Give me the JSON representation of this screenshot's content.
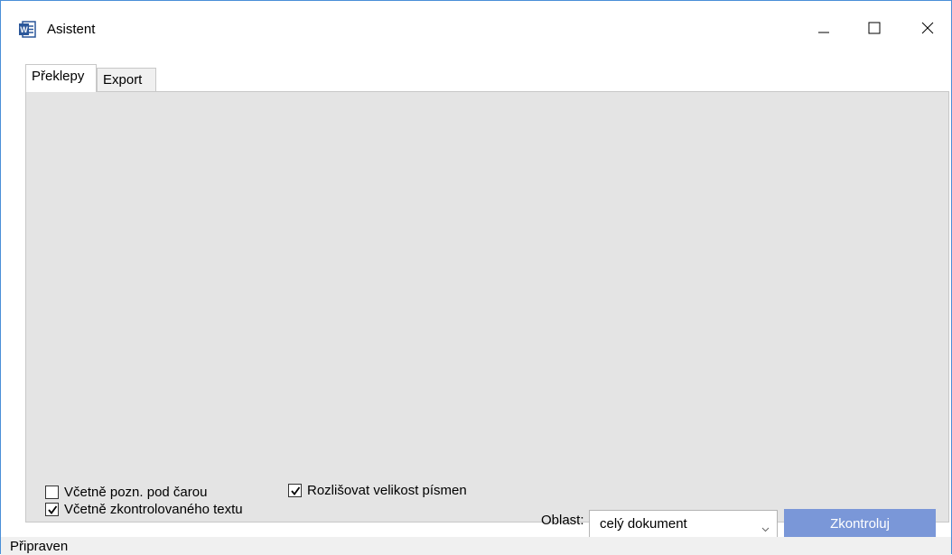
{
  "window": {
    "title": "Asistent",
    "app_icon": "word-icon",
    "controls": [
      "minimize-icon",
      "maximize-icon",
      "close-icon"
    ]
  },
  "tabs": [
    {
      "label": "Překlepy",
      "active": true
    },
    {
      "label": "Export",
      "active": false
    }
  ],
  "options": {
    "include_footnotes": {
      "label": "Včetně pozn. pod čarou",
      "checked": false
    },
    "include_checked_text": {
      "label": "Včetně zkontrolovaného textu",
      "checked": true
    },
    "case_sensitive": {
      "label": "Rozlišovat velikost písmen",
      "checked": true
    }
  },
  "scope": {
    "label": "Oblast:",
    "value": "celý dokument"
  },
  "actions": {
    "check_label": "Zkontroluj"
  },
  "status": {
    "text": "Připraven"
  },
  "colors": {
    "accent_button": "#7a97d8",
    "panel_bg": "#e4e4e4",
    "window_border": "#4a8fd8"
  }
}
